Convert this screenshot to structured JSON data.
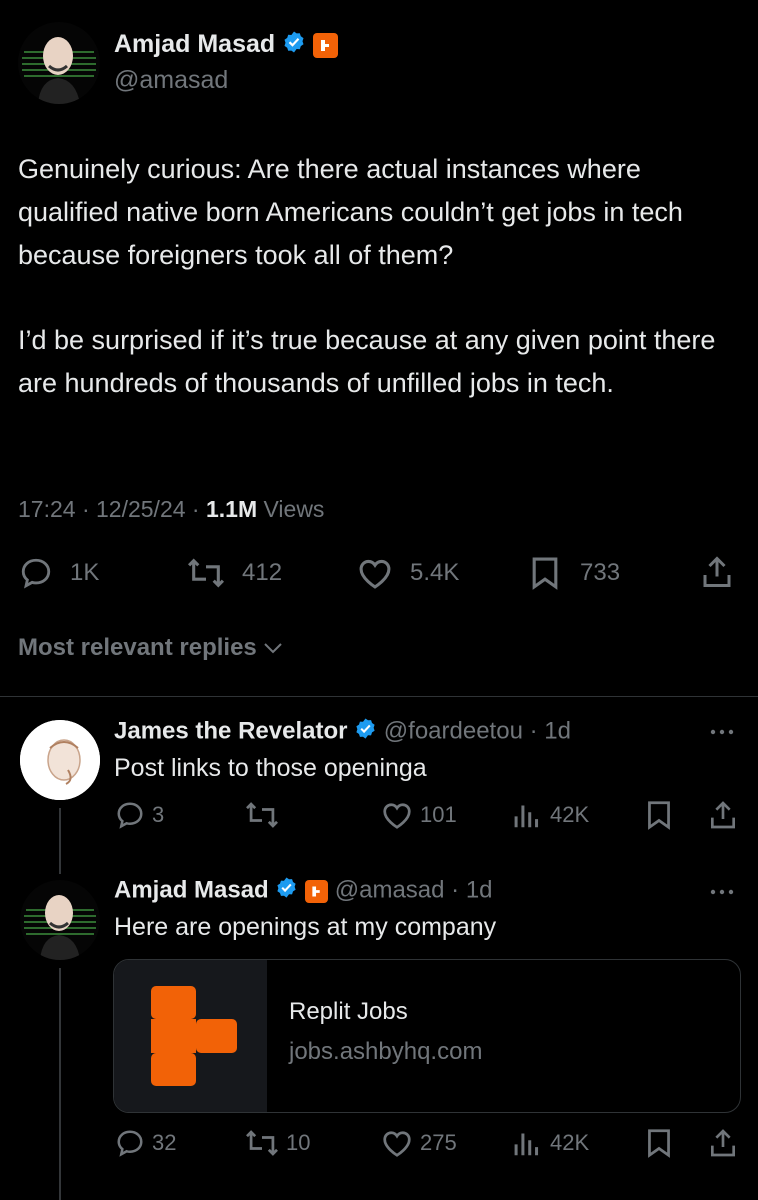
{
  "main_tweet": {
    "author_name": "Amjad Masad",
    "author_handle": "@amasad",
    "text_para1": "Genuinely curious: Are there actual instances where qualified native born Americans couldn’t get jobs in tech because foreigners took all of them?",
    "text_para2": "I’d be surprised if it’s true because at any given point there are hundreds of thousands of unfilled jobs in tech.",
    "timestamp": "17:24 · 12/25/24 · ",
    "views_count": "1.1M",
    "views_label": " Views",
    "replies": "1K",
    "reposts": "412",
    "likes": "5.4K",
    "bookmarks": "733"
  },
  "replies_sort_label": "Most relevant replies",
  "reply1": {
    "author_name": "James the Revelator",
    "author_handle": "@foardeetou",
    "time": " · 1d",
    "text": "Post links to those openinga",
    "replies": "3",
    "reposts": "",
    "likes": "101",
    "views": "42K"
  },
  "reply2": {
    "author_name": "Amjad Masad",
    "author_handle": "@amasad",
    "time": " · 1d",
    "text": "Here are openings at my company",
    "card_title": "Replit Jobs",
    "card_domain": "jobs.ashbyhq.com",
    "replies": "32",
    "reposts": "10",
    "likes": "275",
    "views": "42K"
  },
  "colors": {
    "background": "#000000",
    "text": "#e7e9ea",
    "muted": "#71767b",
    "verified": "#1d9bf0",
    "replit_orange": "#f26207"
  }
}
